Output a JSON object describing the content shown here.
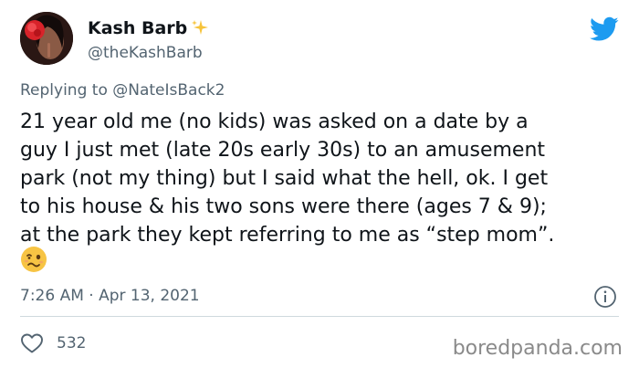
{
  "author": {
    "display_name": "Kash Barb",
    "handle": "@theKashBarb",
    "name_emoji": "sparkles-icon"
  },
  "reply": {
    "prefix": "Replying to ",
    "mention": "@NateIsBack2"
  },
  "tweet": {
    "text": "21 year old me (no kids) was asked on a date by a\nguy I just met (late 20s early 30s) to an amusement\npark (not my thing) but I said what the hell, ok. I get\nto his house & his two sons were there (ages 7 & 9);\nat the park they kept referring to me as “step mom”.",
    "emoji": "woozy-face-icon",
    "timestamp": "7:26 AM · Apr 13, 2021"
  },
  "engagement": {
    "likes": "532"
  },
  "watermark": "boredpanda.com",
  "colors": {
    "twitter_blue": "#1d9bf0",
    "secondary_text": "#536471",
    "divider": "#cfd9de"
  }
}
